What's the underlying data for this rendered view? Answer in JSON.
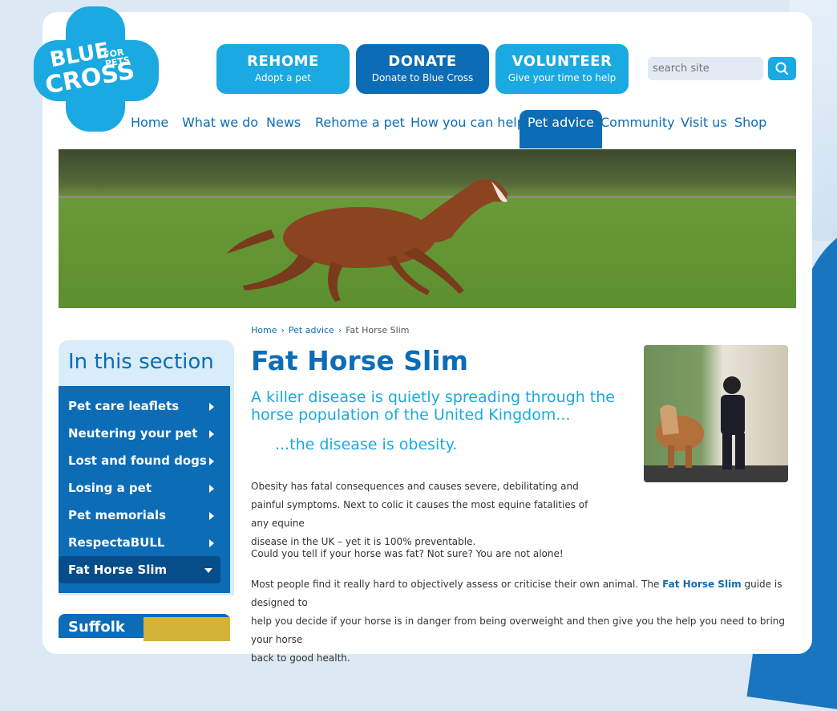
{
  "logo": {
    "line1": "BLUE",
    "line2": "FOR PETS",
    "line3": "CROSS"
  },
  "actions": [
    {
      "title": "REHOME",
      "subtitle": "Adopt a pet"
    },
    {
      "title": "DONATE",
      "subtitle": "Donate to Blue Cross"
    },
    {
      "title": "VOLUNTEER",
      "subtitle": "Give your time to help"
    }
  ],
  "search": {
    "placeholder": "search site"
  },
  "nav": [
    "Home",
    "What we do",
    "News",
    "Rehome a pet",
    "How you can help",
    "Pet advice",
    "Community",
    "Visit us",
    "Shop"
  ],
  "nav_active": "Pet advice",
  "breadcrumb": {
    "home": "Home",
    "section": "Pet advice",
    "current": "Fat Horse Slim"
  },
  "sidebar": {
    "title": "In this section",
    "items": [
      "Pet care leaflets",
      "Neutering your pet",
      "Lost and found dogs",
      "Losing a pet",
      "Pet memorials",
      "RespectaBULL",
      "Fat Horse Slim"
    ],
    "next_box_title": "Suffolk"
  },
  "main": {
    "title": "Fat Horse Slim",
    "lead": "A killer disease is quietly spreading through the horse population of the United Kingdom...",
    "lead2": "...the disease is obesity.",
    "p1_line1": "Obesity has fatal consequences and causes severe, debilitating and",
    "p1_line2": "painful symptoms. Next to colic it causes the most equine fatalities of any equine",
    "p1_line3": "disease in the UK – yet it is 100% preventable.",
    "p2": "Could you tell if your horse was fat? Not sure? You are not alone!",
    "p3_a": "Most people find it really hard to objectively assess or criticise their own animal. The ",
    "p3_bold": "Fat Horse Slim",
    "p3_b": " guide is designed to",
    "p3_line2": "help you decide if your horse is in danger from being overweight and then give you the help you need to bring your horse",
    "p3_line3": "back to good health."
  },
  "colors": {
    "brand_dark": "#0d6cb6",
    "brand_light": "#1aa9e1",
    "sidebar_bg": "#d9ecfa"
  }
}
